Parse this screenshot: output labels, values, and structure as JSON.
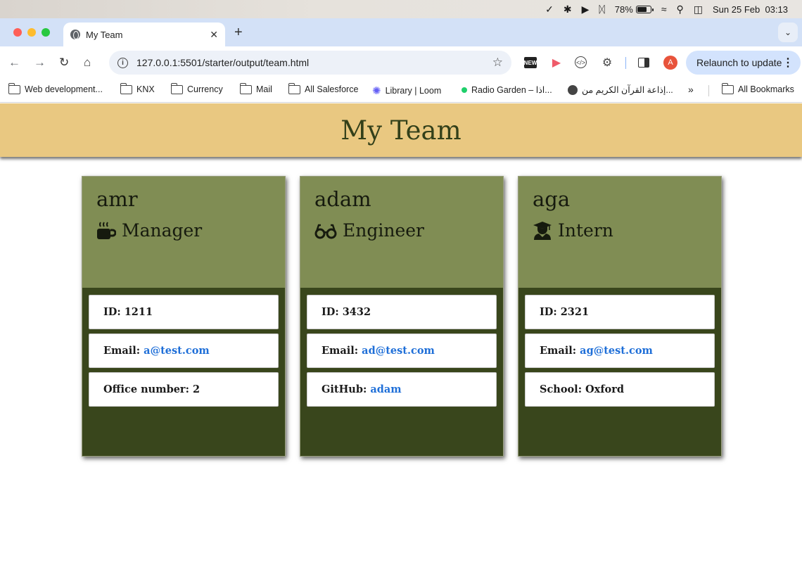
{
  "menubar": {
    "battery_percent": "78%",
    "battery_level": 0.78,
    "date": "Sun 25 Feb",
    "time": "03:13"
  },
  "browser": {
    "tab_title": "My Team",
    "url": "127.0.0.1:5501/starter/output/team.html",
    "relaunch_label": "Relaunch to update",
    "avatar_letter": "A",
    "ext_new_label": "NEW",
    "bookmarks": [
      {
        "label": "Web development...",
        "icon": "folder-icon"
      },
      {
        "label": "KNX",
        "icon": "folder-icon"
      },
      {
        "label": "Currency",
        "icon": "folder-icon"
      },
      {
        "label": "Mail",
        "icon": "folder-icon"
      },
      {
        "label": "All Salesforce",
        "icon": "folder-icon"
      },
      {
        "label": "Library | Loom",
        "icon": "loom-icon"
      },
      {
        "label": "Radio Garden – اذا...",
        "icon": "radio-garden-icon"
      },
      {
        "label": "إذاعة القرآن الكريم من...",
        "icon": "quran-radio-icon"
      }
    ],
    "all_bookmarks_label": "All Bookmarks"
  },
  "page": {
    "title": "My Team",
    "colors": {
      "header_bg": "#e9c881",
      "card_head_bg": "#808d54",
      "card_body_bg": "#39461c",
      "link": "#1f6fd8"
    },
    "cards": [
      {
        "name": "amr",
        "role": "Manager",
        "role_icon": "coffee-mug-icon",
        "id_label": "ID:",
        "id": "1211",
        "email_label": "Email:",
        "email": "a@test.com",
        "extra_label": "Office number:",
        "extra_value": "2",
        "extra_is_link": false
      },
      {
        "name": "adam",
        "role": "Engineer",
        "role_icon": "glasses-icon",
        "id_label": "ID:",
        "id": "3432",
        "email_label": "Email:",
        "email": "ad@test.com",
        "extra_label": "GitHub:",
        "extra_value": "adam",
        "extra_is_link": true
      },
      {
        "name": "aga",
        "role": "Intern",
        "role_icon": "graduate-icon",
        "id_label": "ID:",
        "id": "2321",
        "email_label": "Email:",
        "email": "ag@test.com",
        "extra_label": "School:",
        "extra_value": "Oxford",
        "extra_is_link": false
      }
    ]
  }
}
